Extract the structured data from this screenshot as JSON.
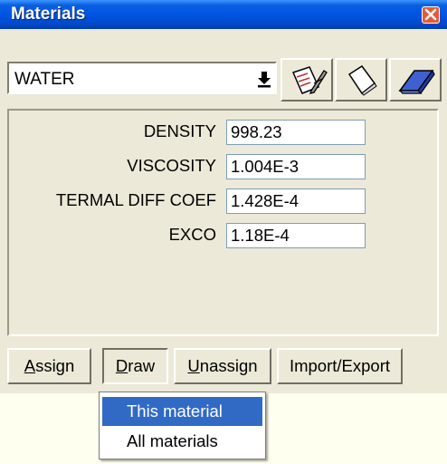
{
  "window": {
    "title": "Materials",
    "close_label": "x"
  },
  "material_select": {
    "value": "WATER"
  },
  "properties": [
    {
      "label": "DENSITY",
      "value": "998.23"
    },
    {
      "label": "VISCOSITY",
      "value": "1.004E-3"
    },
    {
      "label": "TERMAL DIFF COEF",
      "value": "1.428E-4"
    },
    {
      "label": "EXCO",
      "value": "1.18E-4"
    }
  ],
  "buttons": {
    "assign": {
      "mnemonic": "A",
      "rest": "ssign"
    },
    "draw": {
      "mnemonic": "D",
      "rest": "raw"
    },
    "unassign": {
      "mnemonic": "U",
      "rest": "nassign"
    },
    "import_export": "Import/Export"
  },
  "draw_menu": {
    "items": [
      "This material",
      "All materials"
    ],
    "selected_index": 0
  },
  "colors": {
    "titlebar": "#0054e3",
    "menu_highlight": "#316ac5",
    "window_face": "#ece9d8"
  }
}
